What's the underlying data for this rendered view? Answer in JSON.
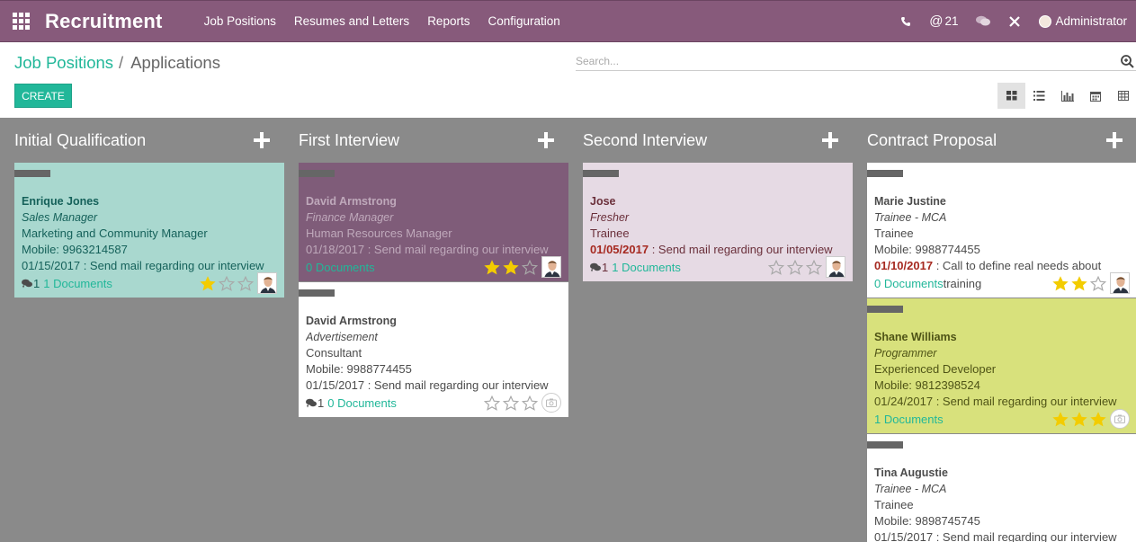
{
  "app": {
    "brand": "Recruitment",
    "menu": [
      "Job Positions",
      "Resumes and Letters",
      "Reports",
      "Configuration"
    ],
    "systray": {
      "messages_count": "21",
      "user": "Administrator"
    }
  },
  "control": {
    "breadcrumb": {
      "parent": "Job Positions",
      "separator": "/",
      "current": "Applications"
    },
    "search_placeholder": "Search...",
    "create_label": "CREATE",
    "views": [
      "kanban",
      "list",
      "graph",
      "calendar",
      "pivot"
    ],
    "active_view": "kanban"
  },
  "colors": {
    "topbar": "#875a7b",
    "accent": "#21b799",
    "kanban_bg": "#8a8a8a",
    "overdue": "#a62a21",
    "star_on": "#f3cc00",
    "star_off": "#a8a8a8"
  },
  "columns": [
    {
      "title": "Initial Qualification",
      "cards": [
        {
          "name": "Enrique Jones",
          "job": "Sales Manager",
          "line3": "Marketing and Community Manager",
          "line4": "Mobile: 9963214587",
          "date": "01/15/2017",
          "activity": " : Send mail regarding our interview",
          "overdue": false,
          "msgs": "1",
          "docs": "1 Documents",
          "docs_extra": "",
          "stars": 1,
          "avatar": true,
          "bg": "#a9d8cf",
          "text": "#15615a"
        }
      ]
    },
    {
      "title": "First Interview",
      "cards": [
        {
          "name": "David Armstrong",
          "job": "Finance Manager",
          "line3": "Human Resources Manager",
          "line4": "",
          "date": "01/18/2017",
          "activity": " : Send mail regarding our interview",
          "overdue": false,
          "msgs": "",
          "docs": "0 Documents",
          "docs_extra": "",
          "stars": 2,
          "avatar": true,
          "bg": "#7f5c79",
          "text": "#bfa9bb"
        },
        {
          "name": "David Armstrong",
          "job": "Advertisement",
          "line3": "Consultant",
          "line4": "Mobile: 9988774455",
          "date": "01/15/2017",
          "activity": " : Send mail regarding our interview",
          "overdue": false,
          "msgs": "1",
          "docs": "0 Documents",
          "docs_extra": "",
          "stars": 0,
          "avatar": false,
          "bg": "#ffffff",
          "text": "#4c4c4c"
        }
      ]
    },
    {
      "title": "Second Interview",
      "cards": [
        {
          "name": "Jose",
          "job": "Fresher",
          "line3": "Trainee",
          "line4": "",
          "date": "01/05/2017",
          "activity": " : Send mail regarding our interview",
          "overdue": true,
          "msgs": "1",
          "docs": "1 Documents",
          "docs_extra": "",
          "stars": 0,
          "avatar": true,
          "bg": "#e6dae4",
          "text": "#6a2f3a"
        }
      ]
    },
    {
      "title": "Contract Proposal",
      "cards": [
        {
          "name": "Marie Justine",
          "job": "Trainee - MCA",
          "line3": "Trainee",
          "line4": "Mobile: 9988774455",
          "date": "01/10/2017",
          "activity": " : Call to define real needs about",
          "overdue": true,
          "msgs": "",
          "docs": "0 Documents",
          "docs_extra": "training",
          "stars": 2,
          "avatar": true,
          "bg": "#ffffff",
          "text": "#4c4c4c"
        },
        {
          "name": "Shane Williams",
          "job": "Programmer",
          "line3": "Experienced Developer",
          "line4": "Mobile: 9812398524",
          "date": "01/24/2017",
          "activity": " : Send mail regarding our interview",
          "overdue": false,
          "msgs": "",
          "docs": "1 Documents",
          "docs_extra": "",
          "stars": 3,
          "avatar": false,
          "bg": "#d8e17c",
          "text": "#4f5416"
        },
        {
          "name": "Tina Augustie",
          "job": "Trainee - MCA",
          "line3": "Trainee",
          "line4": "Mobile: 9898745745",
          "date": "01/15/2017",
          "activity": " : Send mail regarding our interview",
          "overdue": false,
          "msgs": "",
          "docs": "",
          "docs_extra": "",
          "stars": 0,
          "avatar": false,
          "bg": "#ffffff",
          "text": "#4c4c4c"
        }
      ]
    }
  ]
}
